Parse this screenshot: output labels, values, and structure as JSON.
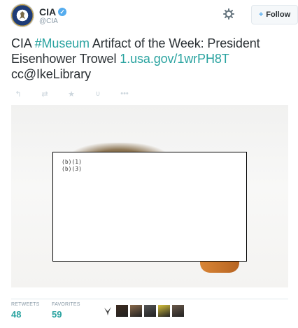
{
  "header": {
    "display_name": "CIA",
    "handle": "@CIA",
    "verified_glyph": "✓",
    "follow_label": "Follow",
    "follow_icon": "+"
  },
  "tweet": {
    "text_start": "CIA ",
    "hashtag": "#Museum",
    "text_middle": " Artifact of the Week: President Eisenhower Trowel ",
    "link": "1.usa.gov/1wrPH8T",
    "text_end": "cc@IkeLibrary"
  },
  "actions": {
    "reply_icon": "reply-icon",
    "retweet_icon": "retweet-icon",
    "favorite_icon": "star-icon",
    "vine_icon": "vine-icon",
    "more_icon": "more-icon",
    "reply_glyph": "↰",
    "retweet_glyph": "⇄",
    "favorite_glyph": "★",
    "vine_glyph": "ʋ",
    "more_glyph": "•••"
  },
  "media": {
    "redaction_text": "(b)(1)\n(b)(3)"
  },
  "stats": {
    "retweets_label": "RETWEETS",
    "retweets_value": "48",
    "favorites_label": "FAVORITES",
    "favorites_value": "59"
  },
  "favoriters": [
    {
      "name": "bird-avatar",
      "color": "#ffffff"
    },
    {
      "name": "user-avatar-1",
      "color": "#3d2b1f"
    },
    {
      "name": "user-avatar-2",
      "color": "#8a6a4b"
    },
    {
      "name": "user-avatar-3",
      "color": "#555555"
    },
    {
      "name": "user-avatar-4",
      "color": "#d6c13c"
    },
    {
      "name": "user-avatar-5",
      "color": "#6b5a4a"
    }
  ],
  "colors": {
    "accent": "#2aa3a0",
    "verified": "#55acee",
    "muted": "#8899a6"
  }
}
